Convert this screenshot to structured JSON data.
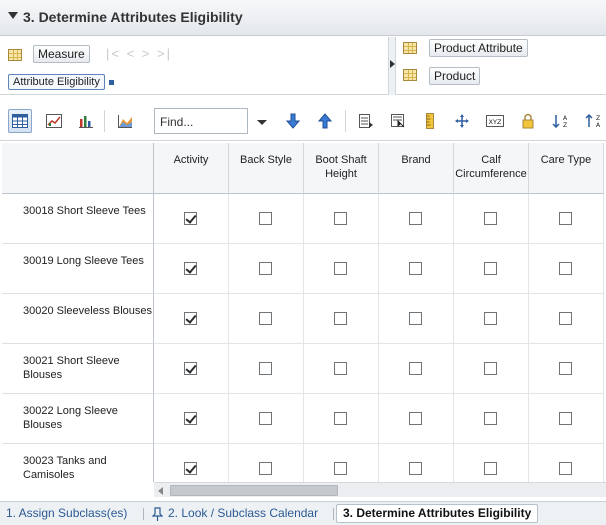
{
  "window": {
    "title": "3. Determine Attributes Eligibility"
  },
  "pivot": {
    "row_tiles": [
      {
        "label": "Measure",
        "icon": "grid-icon"
      },
      {
        "label": "Attribute Eligibility"
      }
    ],
    "column_tiles": [
      {
        "label": "Product Attribute",
        "icon": "grid-icon"
      },
      {
        "label": "Product",
        "icon": "grid-icon"
      }
    ],
    "nav_arrows": "|< < > >|"
  },
  "toolbar": {
    "find_placeholder": "Find...",
    "buttons": [
      "table-view-icon",
      "chart-view-icon",
      "bar-chart-icon",
      "area-chart-icon",
      "arrow-down-icon",
      "arrow-up-icon",
      "show-measures-icon",
      "filter-icon",
      "ruler-icon",
      "pivot-icon",
      "xyz-icon",
      "lock-icon",
      "sort-ascending-icon",
      "sort-descending-icon"
    ]
  },
  "table": {
    "columns": [
      "Activity",
      "Back Style",
      "Boot Shaft Height",
      "Brand",
      "Calf Circumference",
      "Care Type"
    ],
    "rows": [
      {
        "label": "30018 Short Sleeve Tees",
        "values": [
          true,
          false,
          false,
          false,
          false,
          false
        ]
      },
      {
        "label": "30019 Long Sleeve Tees",
        "values": [
          true,
          false,
          false,
          false,
          false,
          false
        ]
      },
      {
        "label": "30020 Sleeveless Blouses",
        "values": [
          true,
          false,
          false,
          false,
          false,
          false
        ]
      },
      {
        "label": "30021 Short Sleeve Blouses",
        "values": [
          true,
          false,
          false,
          false,
          false,
          false
        ]
      },
      {
        "label": "30022 Long Sleeve Blouses",
        "values": [
          true,
          false,
          false,
          false,
          false,
          false
        ]
      },
      {
        "label": "30023 Tanks and Camisoles",
        "values": [
          true,
          false,
          false,
          false,
          false,
          false
        ]
      }
    ]
  },
  "tabs": [
    {
      "label": "1. Assign Subclass(es)",
      "active": false
    },
    {
      "label": "2. Look / Subclass Calendar",
      "active": false
    },
    {
      "label": "3. Determine Attributes Eligibility",
      "active": true
    }
  ],
  "colors": {
    "accent": "#2a5a94",
    "checkbox_border": "#6f7479",
    "header_bg": "#f4f6f8"
  }
}
